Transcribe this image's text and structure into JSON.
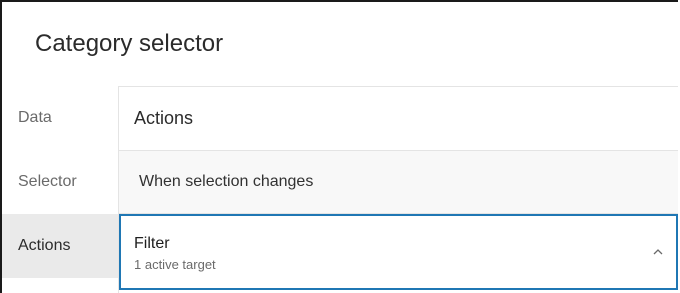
{
  "header": {
    "title": "Category selector"
  },
  "sidebar": {
    "items": [
      {
        "label": "Data"
      },
      {
        "label": "Selector"
      },
      {
        "label": "Actions"
      }
    ]
  },
  "main": {
    "title": "Actions",
    "section_label": "When selection changes",
    "card": {
      "title": "Filter",
      "subtitle": "1 active target",
      "chevron_icon": "chevron-up-icon"
    }
  },
  "colors": {
    "accent": "#1f77b4",
    "active_bg": "#eaeaea",
    "section_bg": "#f8f8f8"
  }
}
